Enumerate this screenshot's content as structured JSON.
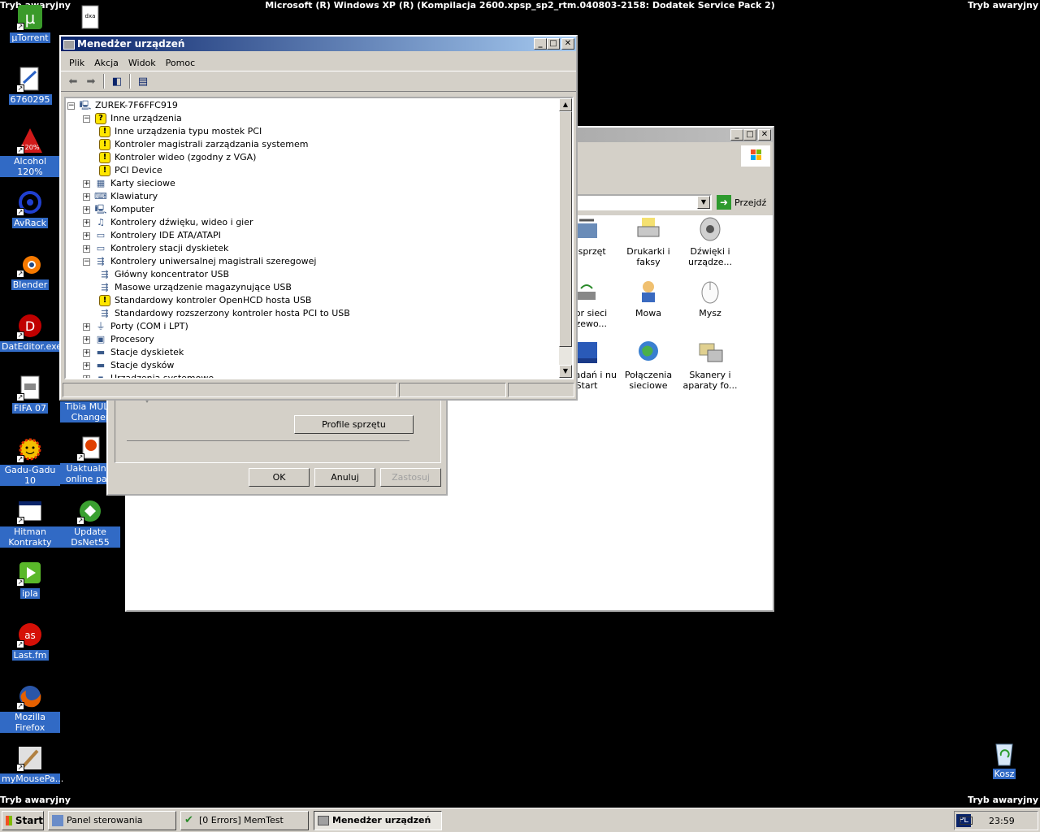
{
  "os": {
    "title": "Microsoft (R) Windows XP (R) (Kompilacja 2600.xpsp_sp2_rtm.040803-2158: Dodatek Service Pack 2)",
    "safe_mode": "Tryb awaryjny"
  },
  "desktop_icons": [
    {
      "label": "µTorrent",
      "icon": "utorrent-icon"
    },
    {
      "label": "6760295",
      "icon": "document-icon"
    },
    {
      "label": "Alcohol 120%",
      "icon": "alcohol-icon"
    },
    {
      "label": "AvRack",
      "icon": "avrack-icon"
    },
    {
      "label": "Blender",
      "icon": "blender-icon"
    },
    {
      "label": "DatEditor.exe",
      "icon": "dateditor-icon"
    },
    {
      "label": "FIFA 07",
      "icon": "fifa-icon"
    },
    {
      "label": "Gadu-Gadu 10",
      "icon": "gadu-gadu-icon"
    },
    {
      "label": "Hitman Kontrakty",
      "icon": "hitman-icon"
    },
    {
      "label": "ipla",
      "icon": "ipla-icon"
    },
    {
      "label": "Last.fm",
      "icon": "lastfm-icon"
    },
    {
      "label": "Mozilla Firefox",
      "icon": "firefox-icon"
    },
    {
      "label": "myMousePa...",
      "icon": "mymousepad-icon"
    },
    {
      "label": "Tibia MULTI Changer",
      "icon": "tibia-icon"
    },
    {
      "label": "Uaktualnie online paki",
      "icon": "update-icon"
    },
    {
      "label": "Update DsNet55",
      "icon": "dsnet-icon"
    },
    {
      "label": "Kosz",
      "icon": "recycle-bin-icon"
    }
  ],
  "device_manager": {
    "title": "Menedżer urządzeń",
    "menu": [
      "Plik",
      "Akcja",
      "Widok",
      "Pomoc"
    ],
    "tree": [
      {
        "label": "ZUREK-7F6FFC919",
        "level": 0,
        "expander": "−",
        "icon": "computer-icon"
      },
      {
        "label": "Inne urządzenia",
        "level": 1,
        "expander": "−",
        "icon": "unknown-device-icon"
      },
      {
        "label": "Inne urządzenia typu mostek PCI",
        "level": 2,
        "expander": "",
        "icon": "warning-icon"
      },
      {
        "label": "Kontroler magistrali zarządzania systemem",
        "level": 2,
        "expander": "",
        "icon": "warning-icon"
      },
      {
        "label": "Kontroler wideo (zgodny z VGA)",
        "level": 2,
        "expander": "",
        "icon": "warning-icon"
      },
      {
        "label": "PCI Device",
        "level": 2,
        "expander": "",
        "icon": "warning-icon"
      },
      {
        "label": "Karty sieciowe",
        "level": 1,
        "expander": "+",
        "icon": "network-card-icon"
      },
      {
        "label": "Klawiatury",
        "level": 1,
        "expander": "+",
        "icon": "keyboard-icon"
      },
      {
        "label": "Komputer",
        "level": 1,
        "expander": "+",
        "icon": "computer-icon"
      },
      {
        "label": "Kontrolery dźwięku, wideo i gier",
        "level": 1,
        "expander": "+",
        "icon": "sound-icon"
      },
      {
        "label": "Kontrolery IDE ATA/ATAPI",
        "level": 1,
        "expander": "+",
        "icon": "ide-icon"
      },
      {
        "label": "Kontrolery stacji dyskietek",
        "level": 1,
        "expander": "+",
        "icon": "floppy-controller-icon"
      },
      {
        "label": "Kontrolery uniwersalnej magistrali szeregowej",
        "level": 1,
        "expander": "−",
        "icon": "usb-icon"
      },
      {
        "label": "Główny koncentrator USB",
        "level": 2,
        "expander": "",
        "icon": "usb-icon"
      },
      {
        "label": "Masowe urządzenie magazynujące USB",
        "level": 2,
        "expander": "",
        "icon": "usb-icon"
      },
      {
        "label": "Standardowy kontroler OpenHCD hosta USB",
        "level": 2,
        "expander": "",
        "icon": "warning-icon"
      },
      {
        "label": "Standardowy rozszerzony kontroler hosta PCI to USB",
        "level": 2,
        "expander": "",
        "icon": "usb-icon"
      },
      {
        "label": "Porty (COM i LPT)",
        "level": 1,
        "expander": "+",
        "icon": "port-icon"
      },
      {
        "label": "Procesory",
        "level": 1,
        "expander": "+",
        "icon": "processor-icon"
      },
      {
        "label": "Stacje dyskietek",
        "level": 1,
        "expander": "+",
        "icon": "floppy-drive-icon"
      },
      {
        "label": "Stacje dysków",
        "level": 1,
        "expander": "+",
        "icon": "disk-drive-icon"
      },
      {
        "label": "Urządzenia systemowe",
        "level": 1,
        "expander": "+",
        "icon": "system-device-icon"
      }
    ]
  },
  "system_properties": {
    "profiles_button": "Profile sprzętu",
    "ok": "OK",
    "cancel": "Anuluj",
    "apply": "Zastosuj"
  },
  "control_panel": {
    "go_button": "Przejdź",
    "items": [
      {
        "label": "aj sprzęt",
        "icon": "add-hardware-icon"
      },
      {
        "label": "Drukarki i faksy",
        "icon": "printer-icon"
      },
      {
        "label": "Dźwięki i urządze...",
        "icon": "speaker-icon"
      },
      {
        "label": "ator sieci przewo...",
        "icon": "wireless-icon"
      },
      {
        "label": "Mowa",
        "icon": "speech-icon"
      },
      {
        "label": "Mysz",
        "icon": "mouse-icon"
      },
      {
        "label": "ek zadań i nu Start",
        "icon": "taskbar-icon"
      },
      {
        "label": "Połączenia sieciowe",
        "icon": "network-connections-icon"
      },
      {
        "label": "Skanery i aparaty fo...",
        "icon": "scanner-icon"
      }
    ]
  },
  "taskbar": {
    "start": "Start",
    "tasks": [
      {
        "label": "Panel sterowania",
        "icon": "control-panel-icon",
        "active": false
      },
      {
        "label": "[0 Errors] MemTest",
        "icon": "memtest-icon",
        "active": false
      },
      {
        "label": "Menedżer urządzeń",
        "icon": "device-manager-icon",
        "active": true
      }
    ],
    "language": "PL",
    "clock": "23:59"
  },
  "colors": {
    "desktop": "#000000",
    "selection": "#316ac5",
    "active_title": "#0a246a",
    "warning": "#ffe600"
  }
}
